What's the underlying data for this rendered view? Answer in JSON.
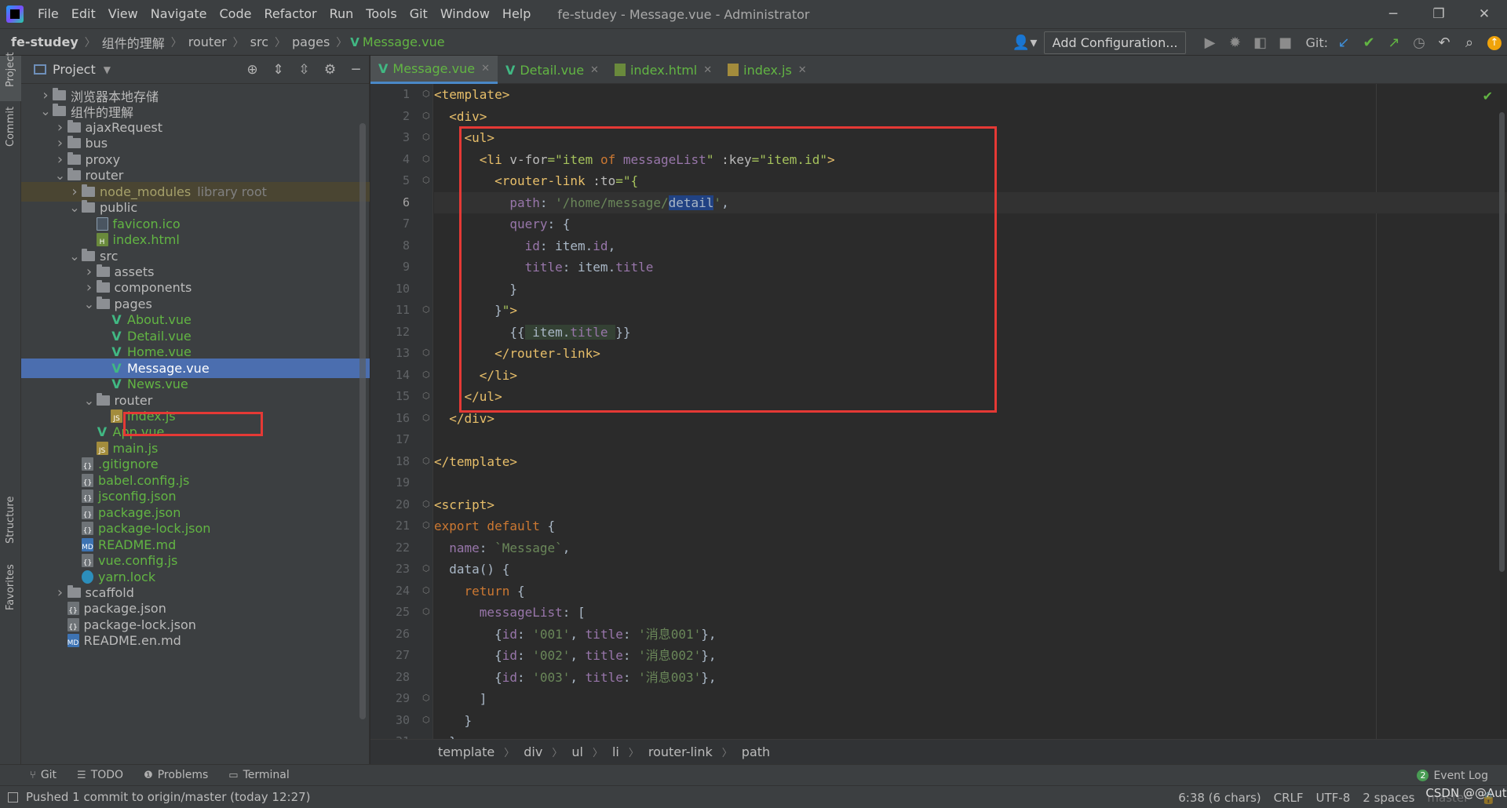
{
  "menubar": {
    "items": [
      "File",
      "Edit",
      "View",
      "Navigate",
      "Code",
      "Refactor",
      "Run",
      "Tools",
      "Git",
      "Window",
      "Help"
    ],
    "window_title": "fe-studey - Message.vue - Administrator"
  },
  "navbar": {
    "crumbs": [
      "fe-studey",
      "组件的理解",
      "router",
      "src",
      "pages",
      "Message.vue"
    ],
    "add_config": "Add Configuration...",
    "git_label": "Git:"
  },
  "left_stripe": {
    "project": "Project",
    "commit": "Commit",
    "structure": "Structure",
    "favorites": "Favorites"
  },
  "project_panel": {
    "title": "Project",
    "tree": [
      {
        "label": "浏览器本地存储",
        "type": "folder",
        "depth": 1,
        "expanded": false
      },
      {
        "label": "组件的理解",
        "type": "folder",
        "depth": 1,
        "expanded": true
      },
      {
        "label": "ajaxRequest",
        "type": "folder",
        "depth": 2,
        "expanded": false
      },
      {
        "label": "bus",
        "type": "folder",
        "depth": 2,
        "expanded": false
      },
      {
        "label": "proxy",
        "type": "folder",
        "depth": 2,
        "expanded": false
      },
      {
        "label": "router",
        "type": "folder",
        "depth": 2,
        "expanded": true
      },
      {
        "label": "node_modules",
        "suffix": "library root",
        "type": "folder-lib",
        "depth": 3,
        "expanded": false
      },
      {
        "label": "public",
        "type": "folder",
        "depth": 3,
        "expanded": true
      },
      {
        "label": "favicon.ico",
        "type": "file",
        "kind": "ico",
        "depth": 4
      },
      {
        "label": "index.html",
        "type": "file",
        "kind": "html",
        "depth": 4
      },
      {
        "label": "src",
        "type": "folder",
        "depth": 3,
        "expanded": true
      },
      {
        "label": "assets",
        "type": "folder",
        "depth": 4,
        "expanded": false
      },
      {
        "label": "components",
        "type": "folder",
        "depth": 4,
        "expanded": false
      },
      {
        "label": "pages",
        "type": "folder",
        "depth": 4,
        "expanded": true
      },
      {
        "label": "About.vue",
        "type": "file",
        "kind": "vue",
        "depth": 5
      },
      {
        "label": "Detail.vue",
        "type": "file",
        "kind": "vue",
        "depth": 5
      },
      {
        "label": "Home.vue",
        "type": "file",
        "kind": "vue",
        "depth": 5
      },
      {
        "label": "Message.vue",
        "type": "file",
        "kind": "vue",
        "depth": 5,
        "selected": true
      },
      {
        "label": "News.vue",
        "type": "file",
        "kind": "vue",
        "depth": 5
      },
      {
        "label": "router",
        "type": "folder",
        "depth": 4,
        "expanded": true
      },
      {
        "label": "index.js",
        "type": "file",
        "kind": "js",
        "depth": 5
      },
      {
        "label": "App.vue",
        "type": "file",
        "kind": "vue",
        "depth": 4
      },
      {
        "label": "main.js",
        "type": "file",
        "kind": "js",
        "depth": 4
      },
      {
        "label": ".gitignore",
        "type": "file",
        "kind": "cfg",
        "depth": 3
      },
      {
        "label": "babel.config.js",
        "type": "file",
        "kind": "cfg",
        "depth": 3
      },
      {
        "label": "jsconfig.json",
        "type": "file",
        "kind": "cfg",
        "depth": 3
      },
      {
        "label": "package.json",
        "type": "file",
        "kind": "cfg",
        "depth": 3
      },
      {
        "label": "package-lock.json",
        "type": "file",
        "kind": "cfg",
        "depth": 3
      },
      {
        "label": "README.md",
        "type": "file",
        "kind": "md",
        "depth": 3
      },
      {
        "label": "vue.config.js",
        "type": "file",
        "kind": "cfg",
        "depth": 3
      },
      {
        "label": "yarn.lock",
        "type": "file",
        "kind": "yarn",
        "depth": 3
      },
      {
        "label": "scaffold",
        "type": "folder",
        "depth": 2,
        "expanded": false
      },
      {
        "label": "package.json",
        "type": "file",
        "kind": "cfg-w",
        "depth": 2
      },
      {
        "label": "package-lock.json",
        "type": "file",
        "kind": "cfg-w",
        "depth": 2
      },
      {
        "label": "README.en.md",
        "type": "file",
        "kind": "md-w",
        "depth": 2
      }
    ]
  },
  "editor_tabs": [
    {
      "label": "Message.vue",
      "kind": "vue",
      "active": true
    },
    {
      "label": "Detail.vue",
      "kind": "vue",
      "active": false
    },
    {
      "label": "index.html",
      "kind": "html",
      "active": false
    },
    {
      "label": "index.js",
      "kind": "js",
      "active": false
    }
  ],
  "editor": {
    "current_line": 6,
    "lines": [
      [
        [
          "tg",
          "<template>"
        ]
      ],
      [
        [
          "br",
          "  "
        ],
        [
          "tg",
          "<div>"
        ]
      ],
      [
        [
          "br",
          "    "
        ],
        [
          "tg",
          "<ul>"
        ]
      ],
      [
        [
          "br",
          "      "
        ],
        [
          "tg",
          "<li "
        ],
        [
          "at",
          "v-for"
        ],
        [
          "av",
          "=\"item "
        ],
        [
          "kw",
          "of "
        ],
        [
          "pv",
          "messageList"
        ],
        [
          "av",
          "\""
        ],
        [
          "at",
          " :key"
        ],
        [
          "av",
          "=\"item.id\""
        ],
        [
          "tg",
          ">"
        ]
      ],
      [
        [
          "br",
          "        "
        ],
        [
          "tg",
          "<router-link "
        ],
        [
          "at",
          ":to"
        ],
        [
          "av",
          "=\"{"
        ]
      ],
      [
        [
          "br",
          "          "
        ],
        [
          "pv",
          "path"
        ],
        [
          "br",
          ": "
        ],
        [
          "st",
          "'/home/message/"
        ],
        [
          "hl",
          "detail"
        ],
        [
          "st",
          "'"
        ],
        [
          "br",
          ","
        ]
      ],
      [
        [
          "br",
          "          "
        ],
        [
          "pv",
          "query"
        ],
        [
          "br",
          ": {"
        ]
      ],
      [
        [
          "br",
          "            "
        ],
        [
          "pv",
          "id"
        ],
        [
          "br",
          ": item."
        ],
        [
          "pv",
          "id"
        ],
        [
          "br",
          ","
        ]
      ],
      [
        [
          "br",
          "            "
        ],
        [
          "pv",
          "title"
        ],
        [
          "br",
          ": item."
        ],
        [
          "pv",
          "title"
        ]
      ],
      [
        [
          "br",
          "          }"
        ]
      ],
      [
        [
          "br",
          "        }"
        ],
        [
          "av",
          "\""
        ],
        [
          "tg",
          ">"
        ]
      ],
      [
        [
          "br",
          "          {{"
        ],
        [
          "hi",
          " item."
        ],
        [
          "hp",
          "title"
        ],
        [
          "hi",
          " "
        ],
        [
          "br",
          "}}"
        ]
      ],
      [
        [
          "br",
          "        "
        ],
        [
          "tg",
          "</router-link>"
        ]
      ],
      [
        [
          "br",
          "      "
        ],
        [
          "tg",
          "</li>"
        ]
      ],
      [
        [
          "br",
          "    "
        ],
        [
          "tg",
          "</ul>"
        ]
      ],
      [
        [
          "br",
          "  "
        ],
        [
          "tg",
          "</div>"
        ]
      ],
      [
        [
          "br",
          ""
        ]
      ],
      [
        [
          "tg",
          "</template>"
        ]
      ],
      [
        [
          "br",
          ""
        ]
      ],
      [
        [
          "tg",
          "<script>"
        ]
      ],
      [
        [
          "kw",
          "export default "
        ],
        [
          "br",
          "{"
        ]
      ],
      [
        [
          "br",
          "  "
        ],
        [
          "pv",
          "name"
        ],
        [
          "br",
          ": "
        ],
        [
          "st",
          "`Message`"
        ],
        [
          "br",
          ","
        ]
      ],
      [
        [
          "br",
          "  data() {"
        ]
      ],
      [
        [
          "br",
          "    "
        ],
        [
          "kw",
          "return "
        ],
        [
          "br",
          "{"
        ]
      ],
      [
        [
          "br",
          "      "
        ],
        [
          "pv",
          "messageList"
        ],
        [
          "br",
          ": ["
        ]
      ],
      [
        [
          "br",
          "        {"
        ],
        [
          "pv",
          "id"
        ],
        [
          "br",
          ": "
        ],
        [
          "st",
          "'001'"
        ],
        [
          "br",
          ", "
        ],
        [
          "pv",
          "title"
        ],
        [
          "br",
          ": "
        ],
        [
          "st",
          "'消息001'"
        ],
        [
          "br",
          "},"
        ]
      ],
      [
        [
          "br",
          "        {"
        ],
        [
          "pv",
          "id"
        ],
        [
          "br",
          ": "
        ],
        [
          "st",
          "'002'"
        ],
        [
          "br",
          ", "
        ],
        [
          "pv",
          "title"
        ],
        [
          "br",
          ": "
        ],
        [
          "st",
          "'消息002'"
        ],
        [
          "br",
          "},"
        ]
      ],
      [
        [
          "br",
          "        {"
        ],
        [
          "pv",
          "id"
        ],
        [
          "br",
          ": "
        ],
        [
          "st",
          "'003'"
        ],
        [
          "br",
          ", "
        ],
        [
          "pv",
          "title"
        ],
        [
          "br",
          ": "
        ],
        [
          "st",
          "'消息003'"
        ],
        [
          "br",
          "},"
        ]
      ],
      [
        [
          "br",
          "      ]"
        ]
      ],
      [
        [
          "br",
          "    }"
        ]
      ],
      [
        [
          "br",
          "  }"
        ]
      ]
    ]
  },
  "code_breadcrumbs": [
    "template",
    "div",
    "ul",
    "li",
    "router-link",
    "path"
  ],
  "bottom_tabs": [
    "Git",
    "TODO",
    "Problems",
    "Terminal"
  ],
  "event_log": {
    "count": "2",
    "label": "Event Log"
  },
  "status": {
    "message": "Pushed 1 commit to origin/master (today 12:27)",
    "position": "6:38 (6 chars)",
    "line_sep": "CRLF",
    "encoding": "UTF-8",
    "indent": "2 spaces",
    "branch": "master",
    "watermark": "CSDN @@Autowire"
  },
  "colors": {
    "accent": "#4b6eaf",
    "vue": "#41b883",
    "highlight_box": "#e53935"
  }
}
